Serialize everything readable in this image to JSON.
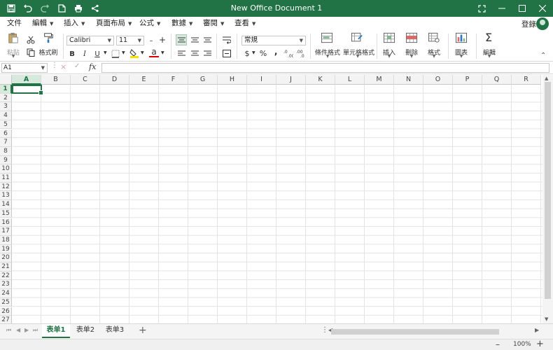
{
  "window": {
    "title": "New Office Document 1"
  },
  "menu": {
    "items": [
      "文件",
      "編輯",
      "插入",
      "頁面布局",
      "公式",
      "數據",
      "審閱",
      "查看"
    ],
    "login": "登錄"
  },
  "ribbon": {
    "paste": "粘貼",
    "format_painter": "格式刷",
    "font_name": "Calibri",
    "font_size": "11",
    "bold": "B",
    "italic": "I",
    "underline": "U",
    "font_color_glyph": "a",
    "number_format": "常規",
    "currency": "$",
    "percent": "%",
    "comma": "‚",
    "conditional_format": "條件格式",
    "cell_style": "單元格格式",
    "insert": "插入",
    "delete": "刪除",
    "format": "格式",
    "chart": "圖表",
    "edit": "編輯",
    "font_size_minus": "–",
    "font_size_plus": "+"
  },
  "formula_bar": {
    "cell_ref": "A1",
    "fx": "fx",
    "cancel": "×",
    "confirm": "✓",
    "value": ""
  },
  "grid": {
    "columns": [
      "A",
      "B",
      "C",
      "D",
      "E",
      "F",
      "G",
      "H",
      "I",
      "J",
      "K",
      "L",
      "M",
      "N",
      "O",
      "P",
      "Q",
      "R"
    ],
    "rows": [
      "1",
      "2",
      "3",
      "4",
      "5",
      "6",
      "7",
      "8",
      "9",
      "10",
      "11",
      "12",
      "13",
      "14",
      "15",
      "16",
      "17",
      "18",
      "19",
      "20",
      "21",
      "22",
      "23",
      "24",
      "25",
      "26",
      "27"
    ],
    "selected_cell": "A1"
  },
  "sheets": [
    "表单1",
    "表单2",
    "表单3"
  ],
  "active_sheet": "表单1",
  "add_sheet": "+",
  "status": {
    "zoom": "100%",
    "zoom_minus": "–",
    "zoom_plus": "+"
  },
  "colors": {
    "accent": "#217346",
    "header_bg": "#f3f3f3",
    "selected_header": "#d7e8dc"
  }
}
